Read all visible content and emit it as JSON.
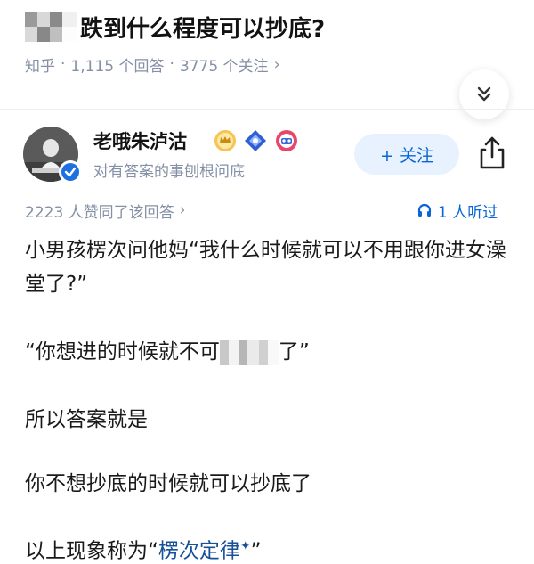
{
  "question": {
    "title_visible": "跌到什么程度可以抄底?",
    "source": "知乎",
    "answers_count": "1,115 个回答",
    "followers_count": "3775 个关注"
  },
  "author": {
    "name": "老哦朱泸沽",
    "bio": "对有答案的事刨根问底",
    "follow_label": "+ 关注"
  },
  "stats": {
    "upvote_text": "2223 人赞同了该回答",
    "listen_text": "1 人听过"
  },
  "content": {
    "p1": "小男孩楞次问他妈“我什么时候就可以不用跟你进女澡堂了?”",
    "p2_before": "“你想进的时候就不可",
    "p2_after": "了”",
    "p3": "所以答案就是",
    "p4": "你不想抄底的时候就可以抄底了",
    "p5_before": "以上现象称为",
    "p5_open_quote": "“",
    "p5_keyword": "楞次定律",
    "p5_close_quote": "”"
  },
  "colors": {
    "accent_blue": "#0a66d8",
    "link_blue": "#175199",
    "meta_gray": "#8590a6",
    "follow_bg": "#e8f2ff"
  },
  "icons": {
    "collapse": "chevron-double-down-icon",
    "share": "share-icon",
    "verified": "verified-check-icon",
    "listen": "headphones-icon"
  }
}
